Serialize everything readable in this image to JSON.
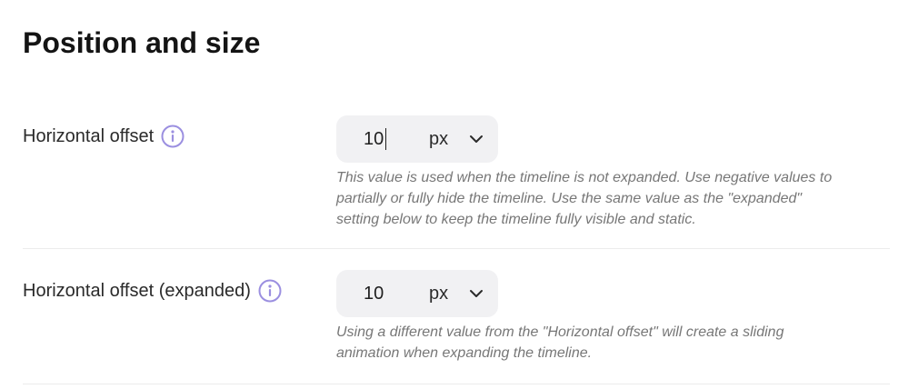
{
  "section": {
    "title": "Position and size"
  },
  "fields": [
    {
      "label": "Horizontal offset",
      "value": "10",
      "unit": "px",
      "help_lines": [
        "This value is used when the timeline is not expanded. Use negative values to",
        "partially or fully hide the timeline. Use the same value as the \"expanded\"",
        "setting below to keep the timeline fully visible and static."
      ],
      "focused": true
    },
    {
      "label": "Horizontal offset (expanded)",
      "value": "10",
      "unit": "px",
      "help_lines": [
        "Using a different value from the \"Horizontal offset\" will create a sliding",
        "animation when expanding the timeline."
      ],
      "focused": false
    }
  ],
  "icons": {
    "info": "info-circle-icon",
    "dropdown": "chevron-down-icon"
  },
  "colors": {
    "info_accent": "#9b8fe0",
    "control_bg": "#f1f1f3",
    "help_text": "#777777",
    "divider": "#ececec"
  }
}
